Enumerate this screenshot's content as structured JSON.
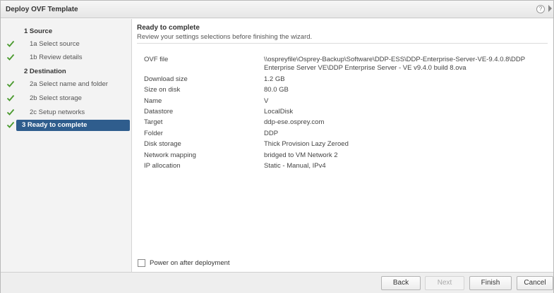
{
  "window": {
    "title": "Deploy OVF Template",
    "help_glyph": "?"
  },
  "sidebar": {
    "steps": [
      {
        "label": "1 Source",
        "done": false,
        "group": true
      },
      {
        "label": "1a Select source",
        "done": true,
        "group": false
      },
      {
        "label": "1b Review details",
        "done": true,
        "group": false
      },
      {
        "label": "2 Destination",
        "done": false,
        "group": true
      },
      {
        "label": "2a Select name and folder",
        "done": true,
        "group": false
      },
      {
        "label": "2b Select storage",
        "done": true,
        "group": false
      },
      {
        "label": "2c Setup networks",
        "done": true,
        "group": false
      },
      {
        "label": "3 Ready to complete",
        "done": true,
        "active": true
      }
    ]
  },
  "main": {
    "heading": "Ready to complete",
    "subheading": "Review your settings selections before finishing the wizard.",
    "details": [
      {
        "key": "OVF file",
        "value": "\\\\ospreyfile\\Osprey-Backup\\Software\\DDP-ESS\\DDP-Enterprise-Server-VE-9.4.0.8\\DDP Enterprise Server VE\\DDP Enterprise Server - VE v9.4.0 build 8.ova"
      },
      {
        "key": "Download size",
        "value": "1.2 GB"
      },
      {
        "key": "Size on disk",
        "value": "80.0 GB"
      },
      {
        "key": "Name",
        "value": "V"
      },
      {
        "key": "Datastore",
        "value": "LocalDisk"
      },
      {
        "key": "Target",
        "value": "ddp-ese.osprey.com"
      },
      {
        "key": "Folder",
        "value": "DDP"
      },
      {
        "key": "Disk storage",
        "value": "Thick Provision Lazy Zeroed"
      },
      {
        "key": "Network mapping",
        "value": "bridged to VM Network 2"
      },
      {
        "key": "IP allocation",
        "value": "Static - Manual, IPv4"
      }
    ],
    "power_on": {
      "label": "Power on after deployment",
      "checked": false
    }
  },
  "footer": {
    "back": "Back",
    "next": "Next",
    "finish": "Finish",
    "cancel": "Cancel"
  },
  "colors": {
    "accent": "#2f5d8d",
    "check": "#4a9a2e"
  }
}
